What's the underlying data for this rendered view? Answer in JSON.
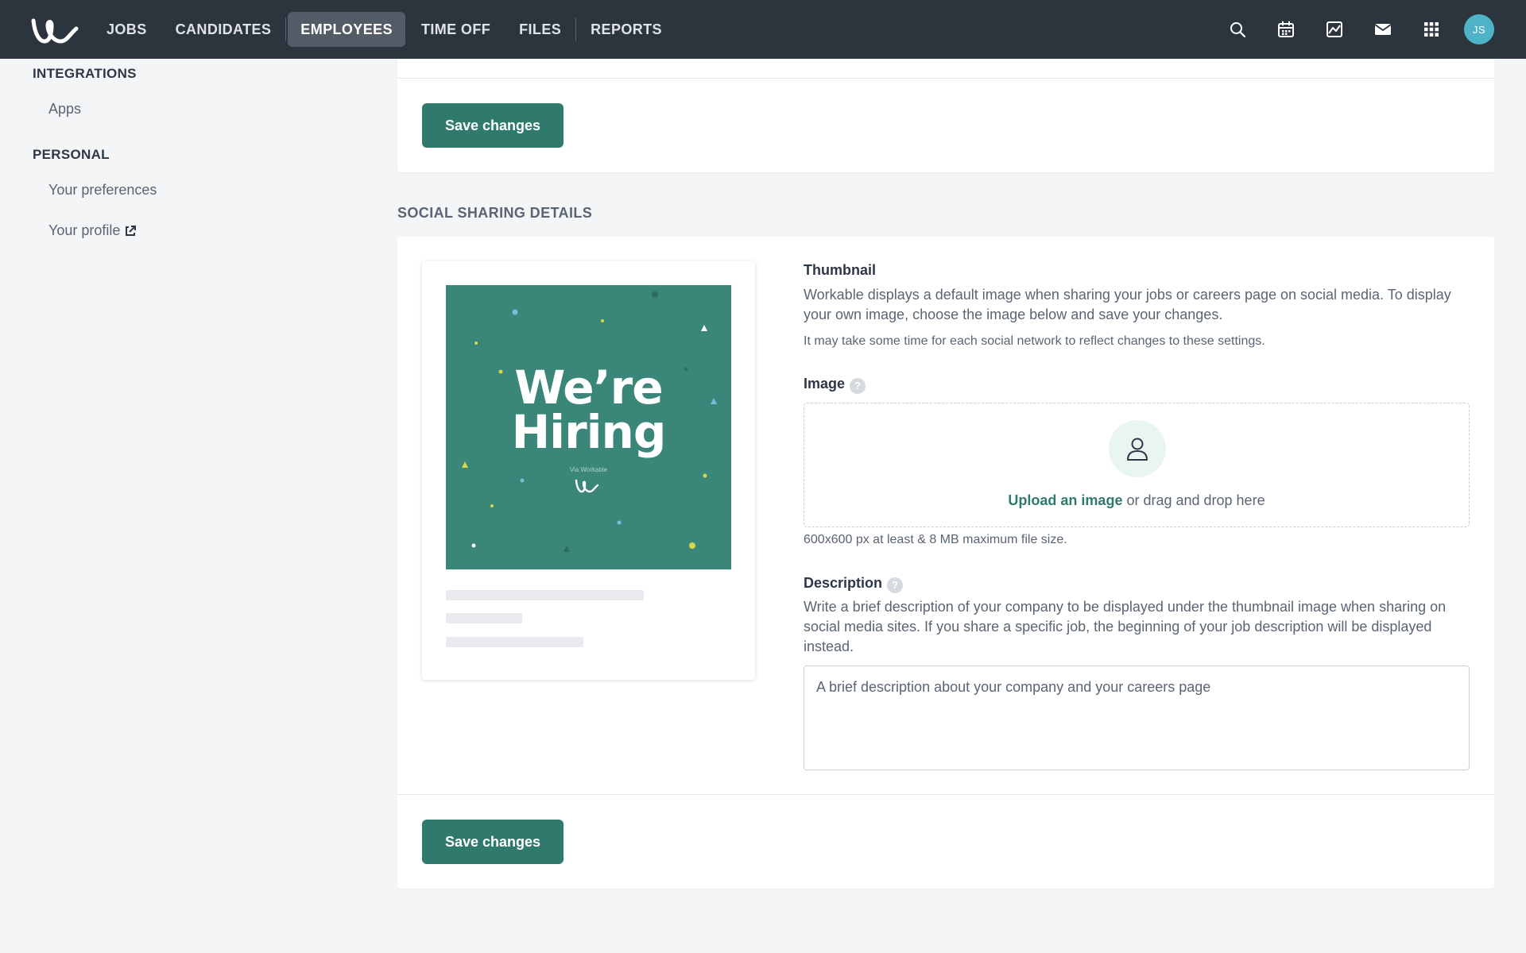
{
  "nav": {
    "items": [
      {
        "label": "JOBS"
      },
      {
        "label": "CANDIDATES"
      },
      {
        "label": "EMPLOYEES"
      },
      {
        "label": "TIME OFF"
      },
      {
        "label": "FILES"
      },
      {
        "label": "REPORTS"
      }
    ],
    "active": "EMPLOYEES",
    "avatar_initials": "JS"
  },
  "sidebar": {
    "integrations_heading": "INTEGRATIONS",
    "integrations_items": [
      {
        "label": "Apps"
      }
    ],
    "personal_heading": "PERSONAL",
    "personal_items": [
      {
        "label": "Your preferences"
      },
      {
        "label": "Your profile"
      }
    ]
  },
  "top_section": {
    "save_label": "Save changes"
  },
  "social": {
    "section_title": "SOCIAL SHARING DETAILS",
    "preview": {
      "line1": "We’re",
      "line2": "Hiring",
      "via": "Via Workable"
    },
    "thumbnail_label": "Thumbnail",
    "thumbnail_desc": "Workable displays a default image when sharing your jobs or careers page on social media. To display your own image, choose the image below and save your changes.",
    "thumbnail_note": "It may take some time for each social network to reflect changes to these settings.",
    "image_label": "Image",
    "upload_link": "Upload an image",
    "upload_rest": " or drag and drop here",
    "image_hint": "600x600 px at least & 8 MB maximum file size.",
    "description_label": "Description",
    "description_help": "Write a brief description of your company to be displayed under the thumbnail image when sharing on social media sites. If you share a specific job, the beginning of your job description will be displayed instead.",
    "description_placeholder": "A brief description about your company and your careers page",
    "save_label": "Save changes"
  },
  "colors": {
    "topbar": "#2c353e",
    "accent": "#2f7a6c",
    "preview_bg": "#3a877a"
  }
}
